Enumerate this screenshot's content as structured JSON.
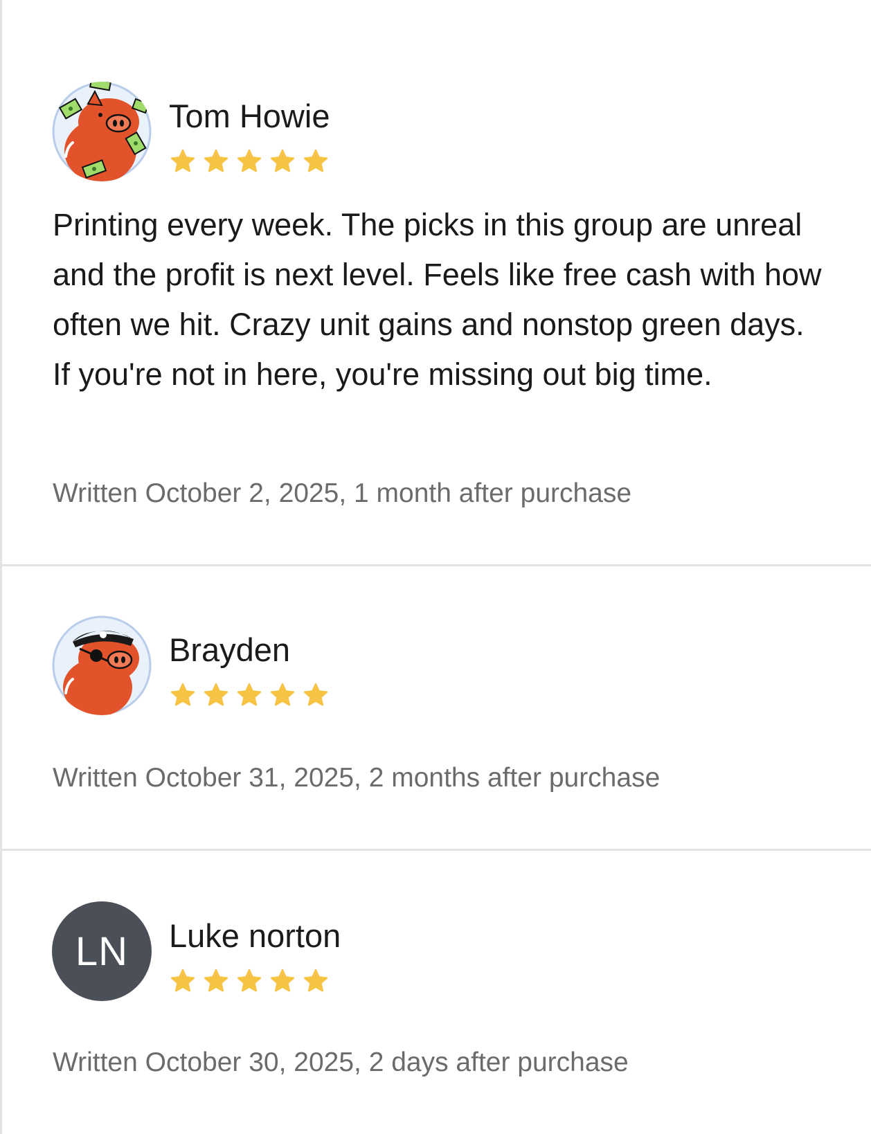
{
  "colors": {
    "star": "#f6c343",
    "divider": "#e4e4e4",
    "meta_text": "#6b6b6b",
    "initials_avatar_bg": "#4b4f57"
  },
  "reviews": [
    {
      "author": "Tom Howie",
      "avatar": "pig-with-money-icon",
      "rating": 5,
      "max_rating": 5,
      "text": "Printing every week. The picks in this group are unreal and the profit is next level. Feels like free cash with how often we hit. Crazy unit gains and nonstop green days. If you're not in here, you're missing out big time.",
      "written": "Written October 2, 2025, 1 month after purchase"
    },
    {
      "author": "Brayden",
      "avatar": "pirate-pig-icon",
      "rating": 5,
      "max_rating": 5,
      "text": "",
      "written": "Written October 31, 2025, 2 months after purchase"
    },
    {
      "author": "Luke norton",
      "avatar_initials": "LN",
      "rating": 5,
      "max_rating": 5,
      "text": "",
      "written": "Written October 30, 2025, 2 days after purchase"
    }
  ]
}
